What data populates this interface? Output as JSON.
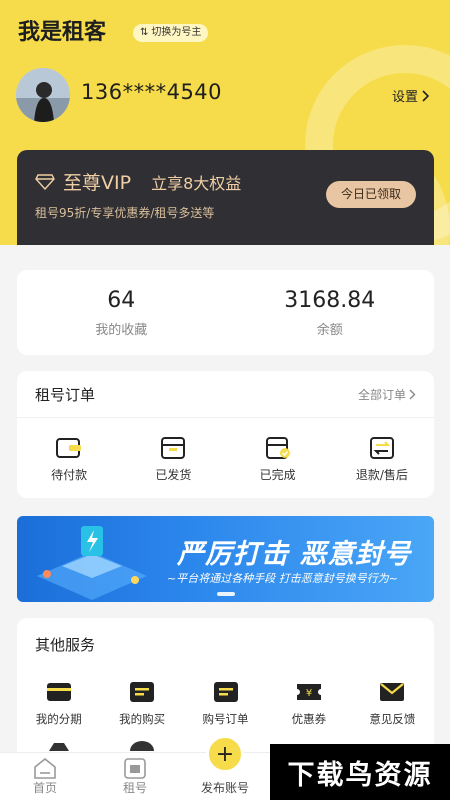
{
  "header": {
    "title": "我是租客",
    "switch_label": "切换为号主",
    "phone": "136****4540",
    "settings_label": "设置"
  },
  "vip": {
    "name": "至尊VIP",
    "subtitle": "立享8大权益",
    "desc": "租号95折/专享优惠券/租号多送等",
    "button_label": "今日已领取"
  },
  "stats": [
    {
      "value": "64",
      "label": "我的收藏"
    },
    {
      "value": "3168.84",
      "label": "余额"
    }
  ],
  "orders": {
    "title": "租号订单",
    "more_label": "全部订单",
    "items": [
      {
        "label": "待付款",
        "icon": "wallet-icon"
      },
      {
        "label": "已发货",
        "icon": "box-icon"
      },
      {
        "label": "已完成",
        "icon": "box-check-icon"
      },
      {
        "label": "退款/售后",
        "icon": "refund-icon"
      }
    ]
  },
  "banner": {
    "title": "严厉打击 恶意封号",
    "subtitle": "~平台将通过各种手段 打击恶意封号换号行为~"
  },
  "services": {
    "title": "其他服务",
    "items": [
      {
        "label": "我的分期",
        "icon": "card-icon"
      },
      {
        "label": "我的购买",
        "icon": "list-icon"
      },
      {
        "label": "购号订单",
        "icon": "order-icon"
      },
      {
        "label": "优惠券",
        "icon": "coupon-icon"
      },
      {
        "label": "意见反馈",
        "icon": "mail-icon"
      }
    ]
  },
  "tabbar": {
    "items": [
      {
        "label": "首页",
        "icon": "home-icon"
      },
      {
        "label": "租号",
        "icon": "rent-icon"
      },
      {
        "label": "发布账号",
        "icon": "plus-icon"
      }
    ]
  },
  "watermark": "下载鸟资源",
  "colors": {
    "accent": "#f6dc4a",
    "vip_bg": "#2f2f34",
    "vip_gold": "#e8c5a3",
    "banner_blue": "#1b6ed8"
  }
}
